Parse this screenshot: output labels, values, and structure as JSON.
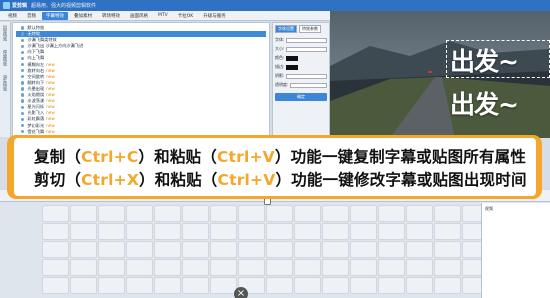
{
  "window": {
    "app_name": "爱剪辑",
    "subtitle": "超易用、强大的视频剪辑软件"
  },
  "menu": {
    "items": [
      "视频",
      "音频",
      "字幕特效",
      "叠加素材",
      "转场特效",
      "画面风格",
      "MTV",
      "卡拉OK",
      "升级与服务"
    ],
    "active_index": 2
  },
  "leftbar": {
    "items": [
      "出现特效",
      "停留特效",
      "消失特效"
    ]
  },
  "effects_list": {
    "rows": [
      {
        "label": "默认特效",
        "tag": ""
      },
      {
        "label": "无特效",
        "tag": "",
        "selected": true
      },
      {
        "label": "沙漏飞舞类特效",
        "tag": ""
      },
      {
        "label": "沙漏飞出 沙漏上方向沙漏飞进",
        "tag": ""
      },
      {
        "label": "向下飞舞",
        "tag": ""
      },
      {
        "label": "向上飞舞",
        "tag": ""
      },
      {
        "label": "模糊向左",
        "tag": "new"
      },
      {
        "label": "旋转向右",
        "tag": "new"
      },
      {
        "label": "空间旋转",
        "tag": "new"
      },
      {
        "label": "翻转向下",
        "tag": "new"
      },
      {
        "label": "光晕出现",
        "tag": "new"
      },
      {
        "label": "火焰燃烧",
        "tag": "new"
      },
      {
        "label": "水波荡漾",
        "tag": "new"
      },
      {
        "label": "星光闪烁",
        "tag": "new"
      },
      {
        "label": "光影飞入",
        "tag": "new"
      },
      {
        "label": "彩虹飘落",
        "tag": "new"
      },
      {
        "label": "梦幻彩光",
        "tag": "new"
      },
      {
        "label": "雪花飞舞",
        "tag": "new"
      }
    ]
  },
  "props": {
    "tabs": [
      "字体设置",
      "特效参数"
    ],
    "labels": [
      "字体:",
      "大小:",
      "颜色:",
      "描边:",
      "阴影:",
      "透明度:"
    ],
    "apply_label": "确定"
  },
  "preview": {
    "overlay_line1": "出发~",
    "overlay_line2": "出发~"
  },
  "banner": {
    "line1": {
      "pre": "复制（",
      "k1": "Ctrl+C",
      "mid": "）和粘贴（",
      "k2": "Ctrl+V",
      "post": "）功能一键复制字幕或贴图所有属性"
    },
    "line2": {
      "pre": "剪切（",
      "k1": "Ctrl+X",
      "mid": "）和粘贴（",
      "k2": "Ctrl+V",
      "post": "）功能一键修改字幕或贴图出现时间"
    }
  },
  "right_list": {
    "title": "视频"
  },
  "colors": {
    "accent": "#f4a72a",
    "titlebar": "#2f72c4",
    "selection": "#3d8ad8"
  }
}
